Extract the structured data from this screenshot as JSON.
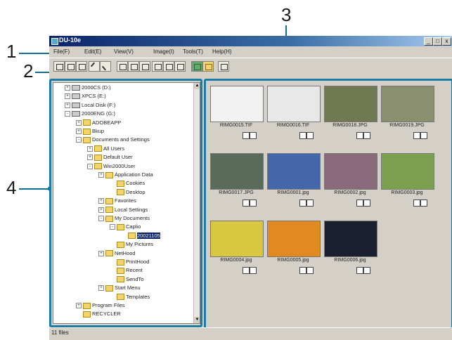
{
  "window": {
    "title": "DU-10e",
    "minimize": "_",
    "maximize": "□",
    "close": "x"
  },
  "menu": [
    "File(F)",
    "Edit(E)",
    "View(V)",
    "Image(I)",
    "Tools(T)",
    "Help(H)"
  ],
  "callouts": {
    "c1": "1",
    "c2": "2",
    "c3": "3",
    "c4": "4"
  },
  "tree": [
    {
      "label": "2000CS (D:)",
      "kind": "drive",
      "pm": "+"
    },
    {
      "label": "XPCS (E:)",
      "kind": "drive",
      "pm": "+"
    },
    {
      "label": "Local Disk (F:)",
      "kind": "drive",
      "pm": "+"
    },
    {
      "label": "2000ENG (G:)",
      "kind": "drive",
      "pm": "-"
    },
    {
      "label": "ADOBEAPP",
      "kind": "folder",
      "pm": "+"
    },
    {
      "label": "Bkup",
      "kind": "folder",
      "pm": "+"
    },
    {
      "label": "Documents and Settings",
      "kind": "folder",
      "pm": "-"
    },
    {
      "label": "All Users",
      "kind": "folder",
      "pm": "+"
    },
    {
      "label": "Default User",
      "kind": "folder",
      "pm": "+"
    },
    {
      "label": "Win2000User",
      "kind": "folder",
      "pm": "-"
    },
    {
      "label": "Application Data",
      "kind": "folder",
      "pm": "+"
    },
    {
      "label": "Cookies",
      "kind": "folder",
      "pm": ""
    },
    {
      "label": "Desktop",
      "kind": "folder",
      "pm": ""
    },
    {
      "label": "Favorites",
      "kind": "folder",
      "pm": "+"
    },
    {
      "label": "Local Settings",
      "kind": "folder",
      "pm": "+"
    },
    {
      "label": "My Documents",
      "kind": "folder",
      "pm": "-"
    },
    {
      "label": "Caplio",
      "kind": "folder",
      "pm": "-"
    },
    {
      "label": "20021105",
      "kind": "folder",
      "pm": "",
      "selected": true
    },
    {
      "label": "My Pictures",
      "kind": "folder",
      "pm": ""
    },
    {
      "label": "NetHood",
      "kind": "folder",
      "pm": "+"
    },
    {
      "label": "PrintHood",
      "kind": "folder",
      "pm": ""
    },
    {
      "label": "Recent",
      "kind": "folder",
      "pm": ""
    },
    {
      "label": "SendTo",
      "kind": "folder",
      "pm": ""
    },
    {
      "label": "Start Menu",
      "kind": "folder",
      "pm": "+"
    },
    {
      "label": "Templates",
      "kind": "folder",
      "pm": ""
    },
    {
      "label": "Program Files",
      "kind": "folder",
      "pm": "+"
    },
    {
      "label": "RECYCLER",
      "kind": "folder",
      "pm": ""
    }
  ],
  "thumbnails": [
    {
      "name": "RIMG0015.TIF",
      "color": "#f2f2f2"
    },
    {
      "name": "RIMG0016.TIF",
      "color": "#e8e8e8"
    },
    {
      "name": "RIMG0018.JPG",
      "color": "#6f7a52"
    },
    {
      "name": "RIMG0019.JPG",
      "color": "#8a8f70"
    },
    {
      "name": "RIMG0017.JPG",
      "color": "#596b5a"
    },
    {
      "name": "RIMG0001.jpg",
      "color": "#4466aa"
    },
    {
      "name": "RIMG0002.jpg",
      "color": "#8a6a7a"
    },
    {
      "name": "RIMG0003.jpg",
      "color": "#7aa050"
    },
    {
      "name": "RIMG0004.jpg",
      "color": "#d8c840"
    },
    {
      "name": "RIMG0005.jpg",
      "color": "#e08a20"
    },
    {
      "name": "RIMG0006.jpg",
      "color": "#1a2030"
    }
  ],
  "status": "11 files"
}
